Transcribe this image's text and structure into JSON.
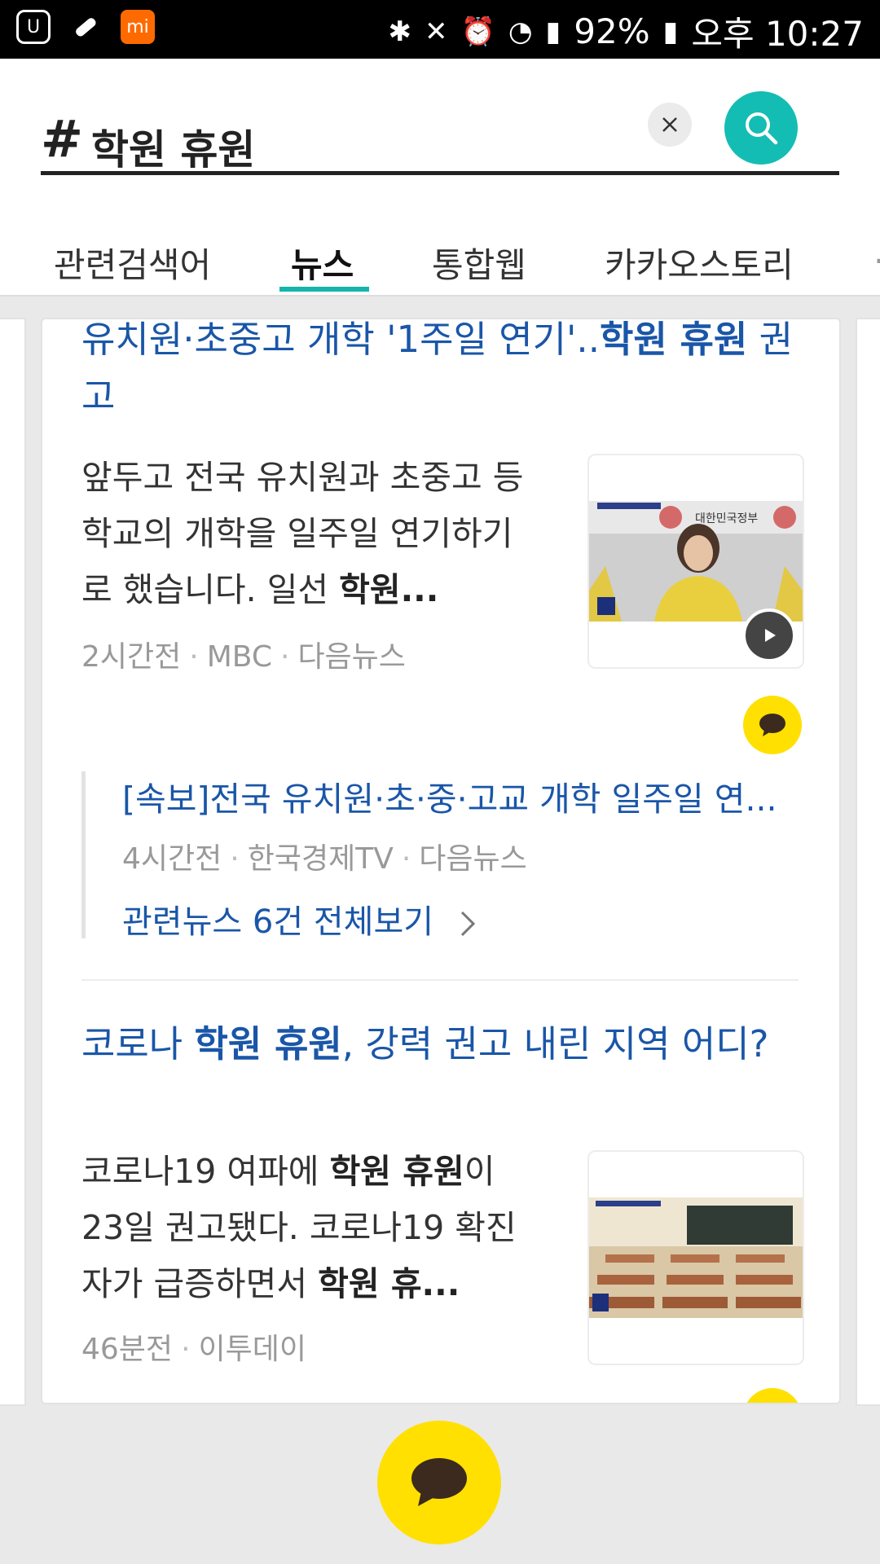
{
  "status_bar": {
    "battery": "92%",
    "time": "오후 10:27"
  },
  "search": {
    "hash": "#",
    "query": "학원 휴원"
  },
  "tabs": [
    {
      "label": "관련검색어"
    },
    {
      "label": "뉴스"
    },
    {
      "label": "통합웹"
    },
    {
      "label": "카카오스토리"
    }
  ],
  "news": [
    {
      "title_a": "유치원·초중고 개학 '1주일 연기'..",
      "title_b": "학원 휴원",
      "title_c": " 권고",
      "snippet_a": "앞두고 전국 유치원과 초중고 등학교의 개학을 일주일 연기하기로 했습니다. 일선 ",
      "snippet_b": "학원...",
      "meta_time": "2시간전",
      "meta_source": "MBC",
      "meta_portal": "다음뉴스",
      "thumb_caption": "대한민국정부",
      "related": {
        "title": "[속보]전국 유치원·초·중·고교 개학 일주일 연...",
        "meta_time": "4시간전",
        "meta_source": "한국경제TV",
        "meta_portal": "다음뉴스",
        "more": "관련뉴스 6건 전체보기"
      }
    },
    {
      "title_a": "코로나 ",
      "title_b": "학원 휴원",
      "title_c": ", 강력 권고 내린 지역 어디?",
      "snippet_a": "코로나19 여파에 ",
      "snippet_b": "학원 휴원",
      "snippet_c": "이 23일 권고됐다. 코로나19 확진자가 급증하면서 ",
      "snippet_d": "학원 휴...",
      "meta_time": "46분전",
      "meta_source": "이투데이"
    }
  ],
  "colors": {
    "accent": "#14bdb3",
    "link": "#1a56a8",
    "kakao_yellow": "#ffe000"
  },
  "icons": [
    "search-icon",
    "close-icon",
    "chat-bubble-icon",
    "play-icon",
    "chevron-right-icon"
  ]
}
